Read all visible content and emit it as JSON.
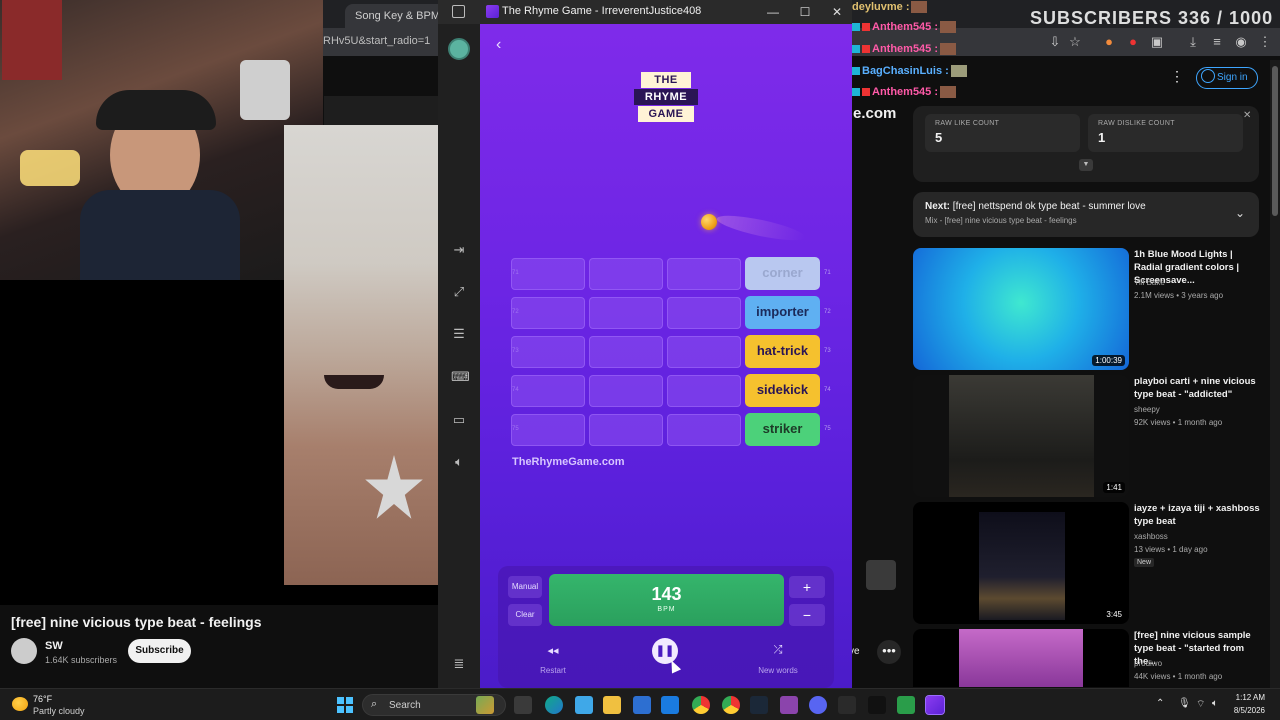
{
  "browser": {
    "tabs": [
      {
        "label": "Song Key & BPM Fin"
      }
    ],
    "address": "RHv5U&start_radio=1"
  },
  "overlay": {
    "subscriber_counter": "SUBSCRIBERS 336 / 1000",
    "chat": [
      {
        "user": "deyluvme",
        "sep": ":"
      },
      {
        "user": "Anthem545",
        "sep": ":"
      },
      {
        "user": "Anthem545",
        "sep": ":"
      },
      {
        "user": "BagChasinLuis",
        "sep": ":"
      },
      {
        "user": "Anthem545",
        "sep": ":"
      }
    ]
  },
  "youtube": {
    "video_title": "[free] nine vicious type beat - feelings",
    "channel": {
      "name": "SW",
      "subscribers": "1.64K subscribers"
    },
    "subscribe_label": "Subscribe",
    "more_label": "•••",
    "partial_com": "e.com",
    "partial_ve": "ve",
    "signin_label": "Sign in",
    "like_panel": {
      "like_label": "RAW LIKE COUNT",
      "like_value": "5",
      "dislike_label": "RAW DISLIKE COUNT",
      "dislike_value": "1",
      "close": "✕"
    },
    "next": {
      "label": "Next:",
      "title": "[free] nettspend ok type beat - summer love",
      "sub": "Mix - [free] nine vicious type beat - feelings"
    },
    "recommendations": [
      {
        "title": "1h Blue Mood Lights | Radial gradient colors | Screensave...",
        "channel": "Yill Bake",
        "meta": "2.1M views • 3 years ago",
        "duration": "1:00:39"
      },
      {
        "title": "playboi carti + nine vicious type beat - \"addicted\"",
        "channel": "sheepy",
        "meta": "92K views • 1 month ago",
        "duration": "1:41"
      },
      {
        "title": "iayze + izaya tiji + xashboss type beat",
        "channel": "xashboss",
        "meta": "13 views • 1 day ago",
        "badge": "New",
        "duration": "3:45"
      },
      {
        "title": "[free] nine vicious sample type beat - \"started from the...",
        "channel": "prodiwo",
        "meta": "44K views • 1 month ago",
        "duration": ""
      }
    ]
  },
  "app": {
    "window_title": "The Rhyme Game - IrreverentJustice408",
    "logo": [
      "THE",
      "RHYME",
      "GAME"
    ],
    "rows": [
      {
        "num": "71",
        "word": "corner",
        "color": "#b9c8f0",
        "text_color": "#9aa8cf"
      },
      {
        "num": "72",
        "word": "importer",
        "color": "#5fb0f2",
        "text_color": "#1b2a5a"
      },
      {
        "num": "73",
        "word": "hat-trick",
        "color": "#f5c12e",
        "text_color": "#2a1555"
      },
      {
        "num": "74",
        "word": "sidekick",
        "color": "#f5c12e",
        "text_color": "#2a1555"
      },
      {
        "num": "75",
        "word": "striker",
        "color": "#4cd17a",
        "text_color": "#1d3b28"
      }
    ],
    "site": "TheRhymeGame.com",
    "controls": {
      "manual": "Manual",
      "clear": "Clear",
      "bpm": "143",
      "bpm_unit": "BPM",
      "plus": "+",
      "minus": "−",
      "restart": "Restart",
      "new_words": "New words"
    }
  },
  "taskbar": {
    "temp": "76°F",
    "weather": "Partly cloudy",
    "search": "Search",
    "time": "1:12 AM",
    "date": "8/5/2026"
  }
}
